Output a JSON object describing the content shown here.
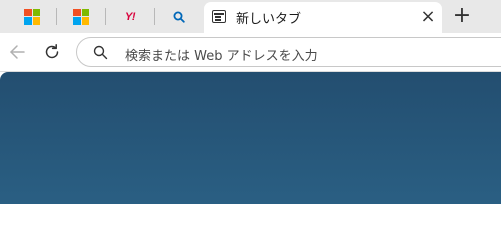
{
  "tabs": {
    "pinned": [
      {
        "name": "microsoft",
        "icon": "microsoft-logo-icon"
      },
      {
        "name": "microsoft",
        "icon": "microsoft-logo-icon"
      },
      {
        "name": "yahoo",
        "icon": "yahoo-japan-logo-icon",
        "logo_text": "Y!"
      },
      {
        "name": "search",
        "icon": "search-icon"
      }
    ],
    "active": {
      "title": "新しいタブ",
      "icon": "new-tab-page-icon"
    },
    "close_icon": "×",
    "new_tab_icon": "+"
  },
  "toolbar": {
    "back_icon": "arrow-left-icon",
    "refresh_icon": "refresh-icon",
    "omnibox_placeholder": "検索または Web アドレスを入力"
  },
  "colors": {
    "ms_red": "#f25022",
    "ms_green": "#7fba00",
    "ms_blue": "#00a4ef",
    "ms_yellow": "#ffb900",
    "yahoo_red": "#d8003b",
    "search_blue": "#0067b8",
    "content_top": "#234e70",
    "content_bottom": "#2a5f83"
  }
}
